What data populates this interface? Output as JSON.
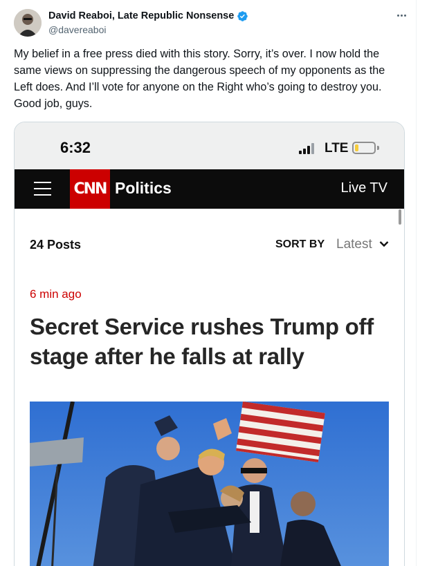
{
  "author": {
    "display_name": "David Reaboi, Late Republic Nonsense",
    "handle": "@davereaboi",
    "verified": true
  },
  "tweet": {
    "text": "My belief in a free press died with this story. Sorry, it’s over. I now hold the same views on suppressing the dangerous speech of my opponents as the Left does. And I’ll vote for anyone on the Right who’s going to destroy you. Good job, guys."
  },
  "screenshot": {
    "status_bar": {
      "time": "6:32",
      "network": "LTE",
      "battery_level": 0.2
    },
    "nav": {
      "logo": "CNN",
      "section": "Politics",
      "live_tv": "Live TV"
    },
    "feed": {
      "posts_count": "24 Posts",
      "sort_label": "SORT BY",
      "sort_value": "Latest"
    },
    "post": {
      "timestamp": "6 min ago",
      "headline": "Secret Service rushes Trump off stage after he falls at rally"
    }
  },
  "colors": {
    "cnn_red": "#cc0000",
    "verified_blue": "#1d9bf0",
    "text_primary": "#0f1419",
    "text_secondary": "#536471"
  },
  "icons": [
    "verified-badge-icon",
    "more-options-icon",
    "hamburger-icon",
    "signal-icon",
    "battery-icon",
    "chevron-down-icon"
  ]
}
